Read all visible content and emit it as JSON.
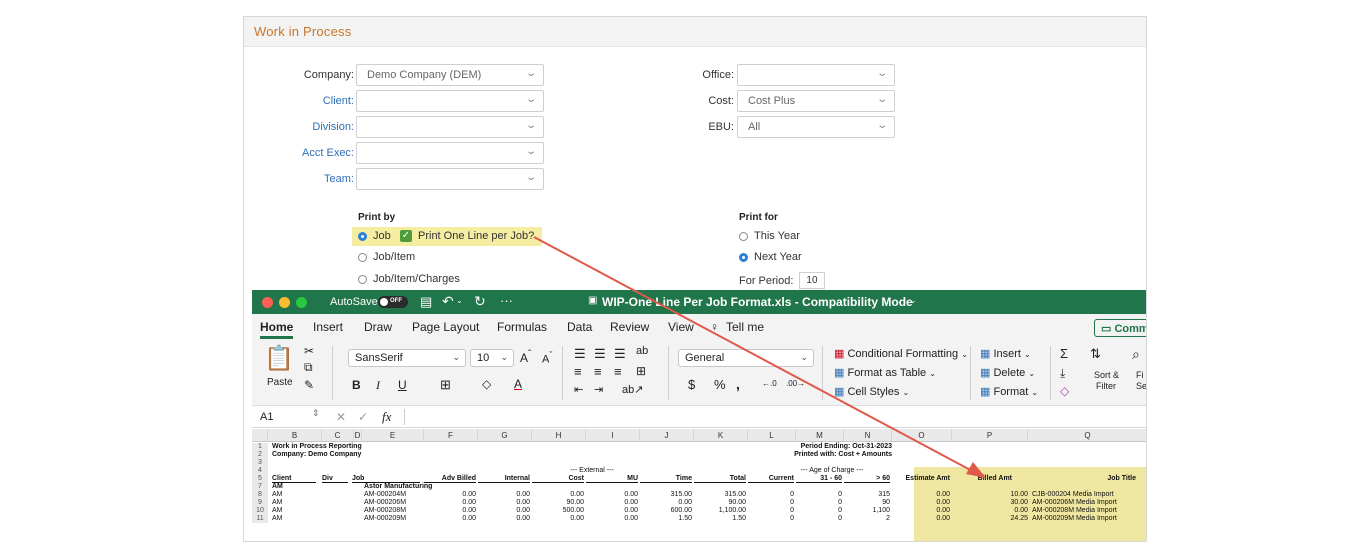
{
  "form": {
    "title": "Work in Process",
    "left_fields": [
      {
        "label": "Company:",
        "value": "Demo Company (DEM)"
      },
      {
        "label": "Client:",
        "value": ""
      },
      {
        "label": "Division:",
        "value": ""
      },
      {
        "label": "Acct Exec:",
        "value": ""
      },
      {
        "label": "Team:",
        "value": ""
      }
    ],
    "right_fields": [
      {
        "label": "Office:",
        "value": ""
      },
      {
        "label": "Cost:",
        "value": "Cost Plus"
      },
      {
        "label": "EBU:",
        "value": "All"
      }
    ],
    "print_by": {
      "label": "Print by",
      "options": [
        "Job",
        "Job/Item",
        "Job/Item/Charges"
      ],
      "selected": "Job",
      "checkbox_label": "Print One Line per Job?"
    },
    "print_for": {
      "label": "Print for",
      "options": [
        "This Year",
        "Next Year"
      ],
      "selected": "Next Year",
      "period_label": "For Period:",
      "period_value": "10"
    }
  },
  "excel": {
    "autosave": "AutoSave",
    "toggle": "OFF",
    "file_title": "WIP-One Line Per Job Format.xls  -  Compatibility Mode",
    "tabs": [
      "Home",
      "Insert",
      "Draw",
      "Page Layout",
      "Formulas",
      "Data",
      "Review",
      "View",
      "Tell me"
    ],
    "comments_label": "Comm",
    "ribbon": {
      "paste": "Paste",
      "font": "SansSerif",
      "size": "10",
      "number_format": "General",
      "conditional_formatting": "Conditional Formatting",
      "format_as_table": "Format as Table",
      "cell_styles": "Cell Styles",
      "insert": "Insert",
      "delete": "Delete",
      "format": "Format",
      "sort_filter_1": "Sort &",
      "sort_filter_2": "Filter",
      "find_1": "Fi",
      "find_2": "Se"
    },
    "name_box": "A1",
    "fx": "fx",
    "columns": [
      "B",
      "C",
      "D",
      "E",
      "F",
      "G",
      "H",
      "I",
      "J",
      "K",
      "L",
      "M",
      "N",
      "O",
      "P",
      "Q"
    ],
    "rows": {
      "r1_left": "Work in Process Reporting",
      "r1_right": "Period Ending: Oct-31-2023",
      "r2_left": "Company: Demo Company",
      "r2_right": "Printed with: Cost + Amounts",
      "r4_external": "---  External  ---",
      "r4_age": "---  Age of Charge  ---",
      "headers": [
        "Client",
        "Div",
        "Job",
        "Adv Billed",
        "Internal",
        "Cost",
        "MU",
        "Time",
        "Total",
        "Current",
        "31 - 60",
        "> 60",
        "Estimate Amt",
        "Billed Amt",
        "Job Title"
      ],
      "r7_client": "AM",
      "r7_name": "Astor Manufacturing",
      "data": [
        [
          "AM",
          "AM-000204M",
          "0.00",
          "0.00",
          "0.00",
          "0.00",
          "315.00",
          "315.00",
          "0",
          "0",
          "315",
          "0.00",
          "10.00",
          "CJB-000204 Media Import"
        ],
        [
          "AM",
          "AM-000206M",
          "0.00",
          "0.00",
          "90.00",
          "0.00",
          "0.00",
          "90.00",
          "0",
          "0",
          "90",
          "0.00",
          "30.00",
          "AM-000206M Media Import"
        ],
        [
          "AM",
          "AM-000208M",
          "0.00",
          "0.00",
          "500.00",
          "0.00",
          "600.00",
          "1,100.00",
          "0",
          "0",
          "1,100",
          "0.00",
          "0.00",
          "AM-000208M Media Import"
        ],
        [
          "AM",
          "AM-000209M",
          "0.00",
          "0.00",
          "0.00",
          "0.00",
          "1.50",
          "1.50",
          "0",
          "0",
          "2",
          "0.00",
          "24.25",
          "AM-000209M Media Import"
        ]
      ]
    }
  },
  "colors": {
    "accent": "#c8762b",
    "excel_green": "#21754a",
    "highlight": "#f4eda2",
    "arrow": "#e0584a"
  }
}
